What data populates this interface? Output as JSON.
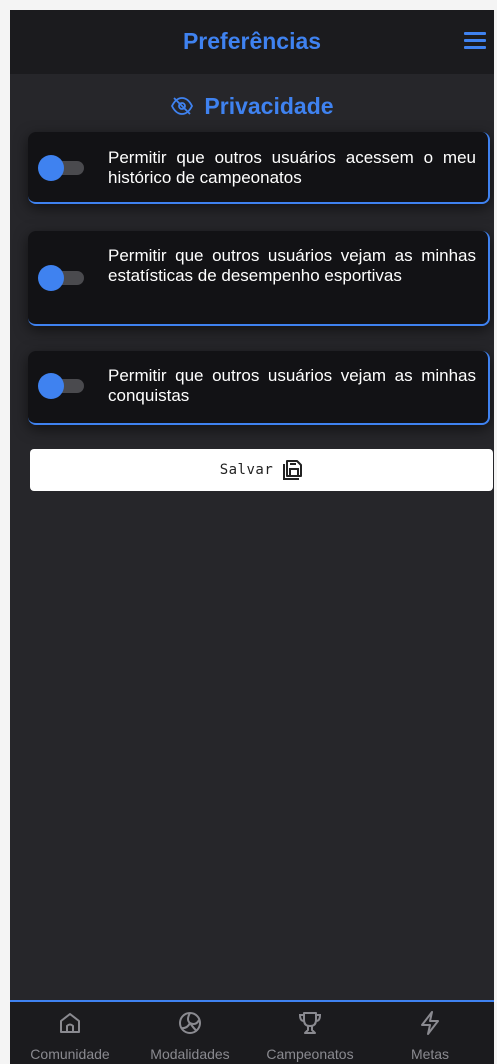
{
  "header": {
    "title": "Preferências"
  },
  "section": {
    "title": "Privacidade"
  },
  "settings": [
    {
      "label": "Permitir que outros usuários acessem o meu histórico de campeonatos",
      "enabled": true
    },
    {
      "label": "Permitir que outros usuários vejam as minhas estatísticas de desempenho esportivas",
      "enabled": true
    },
    {
      "label": "Permitir que outros usuários vejam as minhas conquistas",
      "enabled": true
    }
  ],
  "save_button": {
    "label": "Salvar"
  },
  "bottom_nav": {
    "items": [
      {
        "label": "Comunidade",
        "icon": "home-icon"
      },
      {
        "label": "Modalidades",
        "icon": "volleyball-icon"
      },
      {
        "label": "Campeonatos",
        "icon": "trophy-icon"
      },
      {
        "label": "Metas",
        "icon": "lightning-icon"
      }
    ]
  },
  "colors": {
    "accent": "#3f82f0",
    "background": "#26262a",
    "card": "#121215",
    "bar": "#1b1b1e"
  }
}
